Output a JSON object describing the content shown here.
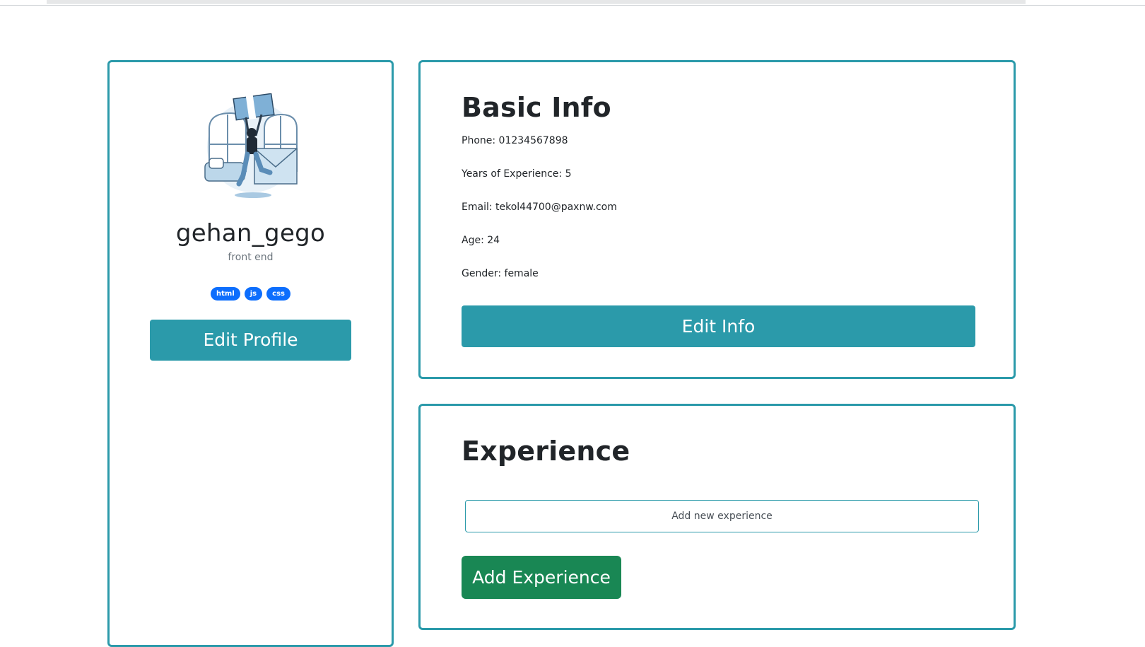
{
  "profile": {
    "username": "gehan_gego",
    "role": "front end",
    "tags": [
      "html",
      "js",
      "css"
    ],
    "edit_button": "Edit Profile",
    "avatar_icon": "person-jumping-illustration-icon"
  },
  "basic_info": {
    "title": "Basic Info",
    "phone": "Phone: 01234567898",
    "years": "Years of Experience: 5",
    "email": "Email: tekol44700@paxnw.com",
    "age": "Age: 24",
    "gender": "Gender: female",
    "edit_button": "Edit Info"
  },
  "experience": {
    "title": "Experience",
    "input_placeholder": "Add new experience",
    "add_button": "Add Experience"
  },
  "colors": {
    "accent": "#2b9aaa",
    "tag": "#0d6efd",
    "success": "#198754"
  }
}
